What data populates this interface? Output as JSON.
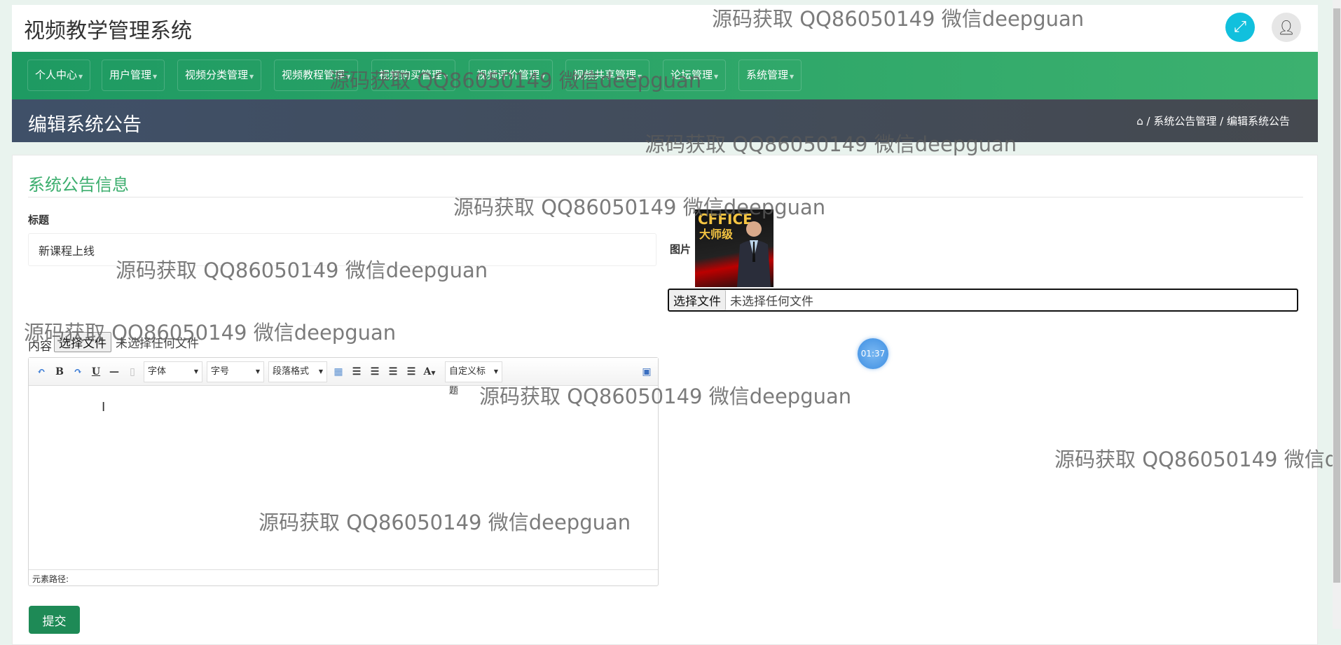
{
  "header": {
    "title": "视频教学管理系统",
    "fullscreen_icon": "expand-icon",
    "user_icon": "user-icon",
    "accent": "#11c0dd"
  },
  "nav": {
    "items": [
      {
        "label": "个人中心"
      },
      {
        "label": "用户管理"
      },
      {
        "label": "视频分类管理"
      },
      {
        "label": "视频教程管理"
      },
      {
        "label": "视频购买管理"
      },
      {
        "label": "视频评价管理"
      },
      {
        "label": "视频共享管理"
      },
      {
        "label": "论坛管理"
      },
      {
        "label": "系统管理"
      }
    ],
    "color": "#2aa466"
  },
  "banner": {
    "title": "编辑系统公告",
    "breadcrumb": [
      "系统公告管理",
      "编辑系统公告"
    ],
    "separator": "/"
  },
  "form": {
    "section_title": "系统公告信息",
    "title_label": "标题",
    "title_value": "新课程上线",
    "image_label": "图片",
    "image_text": [
      "CFFICE",
      "大师级"
    ],
    "file_button": "选择文件",
    "file_status": "未选择任何文件",
    "content_label": "内容",
    "editor": {
      "font_combo": "字体",
      "size_combo": "字号",
      "paragraph_combo": "段落格式",
      "custom_title_combo": "自定义标题",
      "bold": "B",
      "underline": "U",
      "font_color": "A",
      "path_label": "元素路径:"
    },
    "submit": "提交"
  },
  "timer": "01:37",
  "watermark": "源码获取 QQ86050149 微信deepguan"
}
